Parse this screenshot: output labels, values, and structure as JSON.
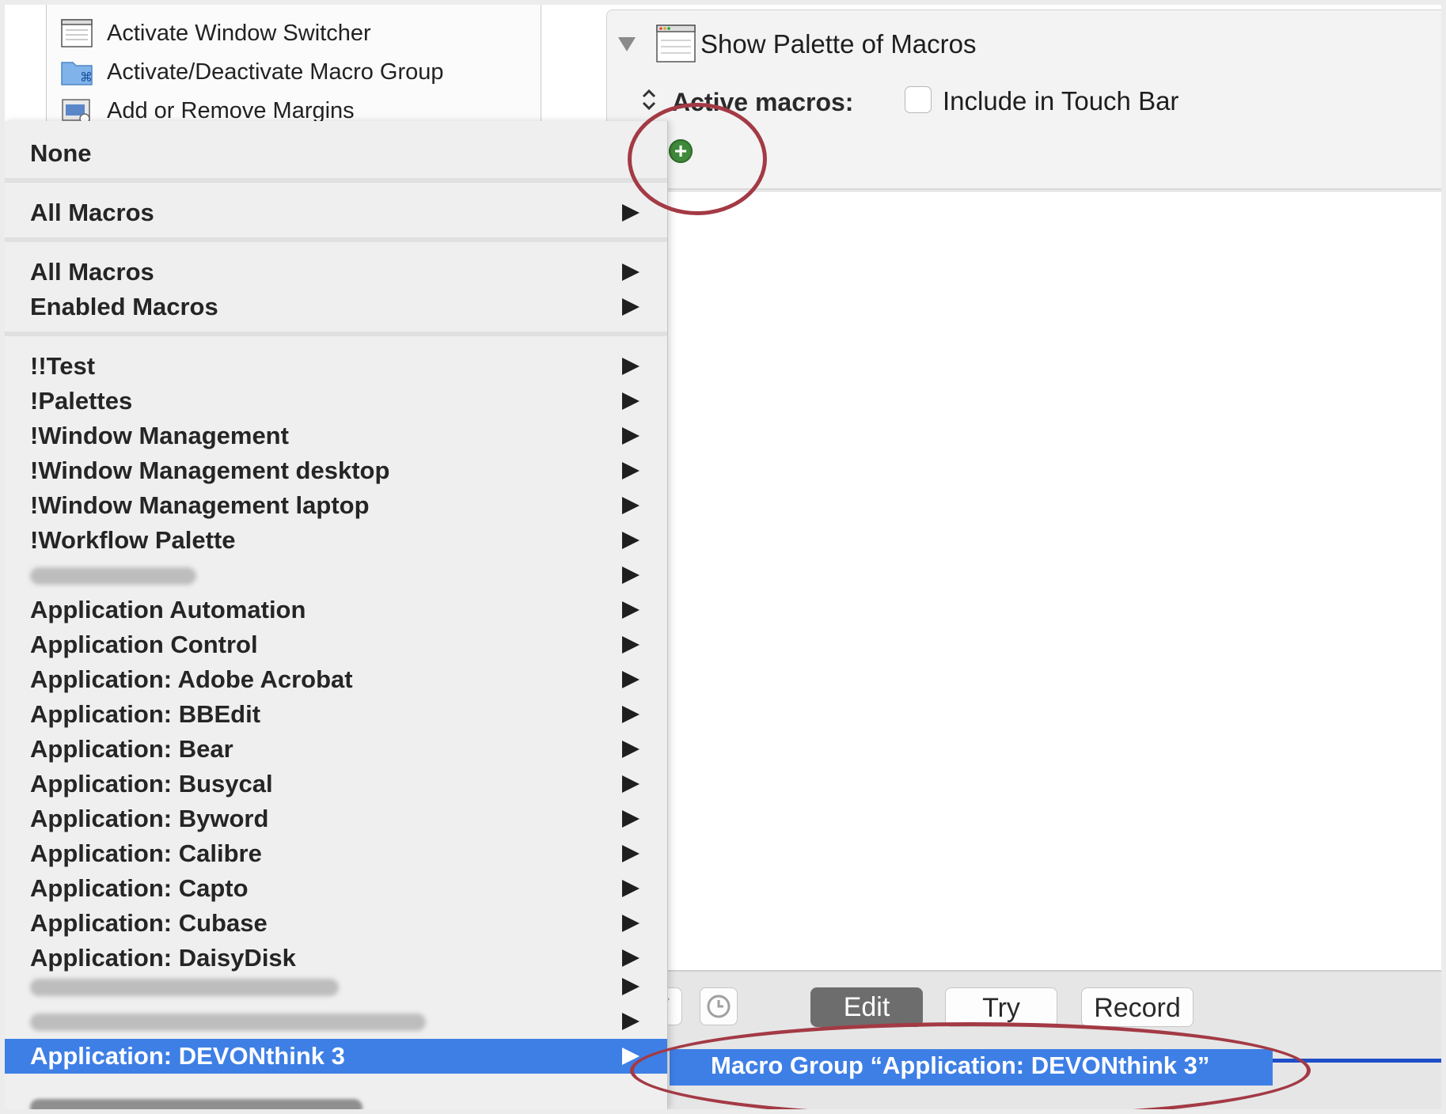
{
  "action_list": {
    "items": [
      {
        "label": "Activate Window Switcher",
        "icon": "window-icon"
      },
      {
        "label": "Activate/Deactivate Macro Group",
        "icon": "folder-command-icon"
      },
      {
        "label": "Add or Remove Margins",
        "icon": "margins-icon"
      }
    ]
  },
  "action_panel": {
    "title": "Show Palette of Macros",
    "active_macros_label": "Active macros:",
    "touch_bar_label": "Include in Touch Bar",
    "touch_bar_checked": false,
    "add_icon": "plus-circle-icon"
  },
  "menu": {
    "none": "None",
    "all_macros_1": "All Macros",
    "all_macros_2": "All Macros",
    "enabled_macros": "Enabled Macros",
    "groups": [
      "!!Test",
      "!Palettes",
      "!Window Management",
      "!Window Management desktop",
      "!Window Management laptop",
      "!Workflow Palette",
      "",
      "Application Automation",
      "Application Control",
      "Application: Adobe Acrobat",
      "Application: BBEdit",
      "Application: Bear",
      "Application: Busycal",
      "Application: Byword",
      "Application: Calibre",
      "Application: Capto",
      "Application: Cubase",
      "Application: DaisyDisk"
    ],
    "selected": "Application: DEVONthink 3",
    "arrow_icon": "chevron-right-icon"
  },
  "submenu": {
    "label": "Macro Group “Application: DEVONthink 3”"
  },
  "toolbar": {
    "check_icon": "checkmark-icon",
    "clock_icon": "clock-icon",
    "edit": "Edit",
    "try": "Try",
    "record": "Record"
  },
  "colors": {
    "accent": "#3e7fe6",
    "annotation": "#a33a45",
    "add_green": "#3f8a3a"
  }
}
